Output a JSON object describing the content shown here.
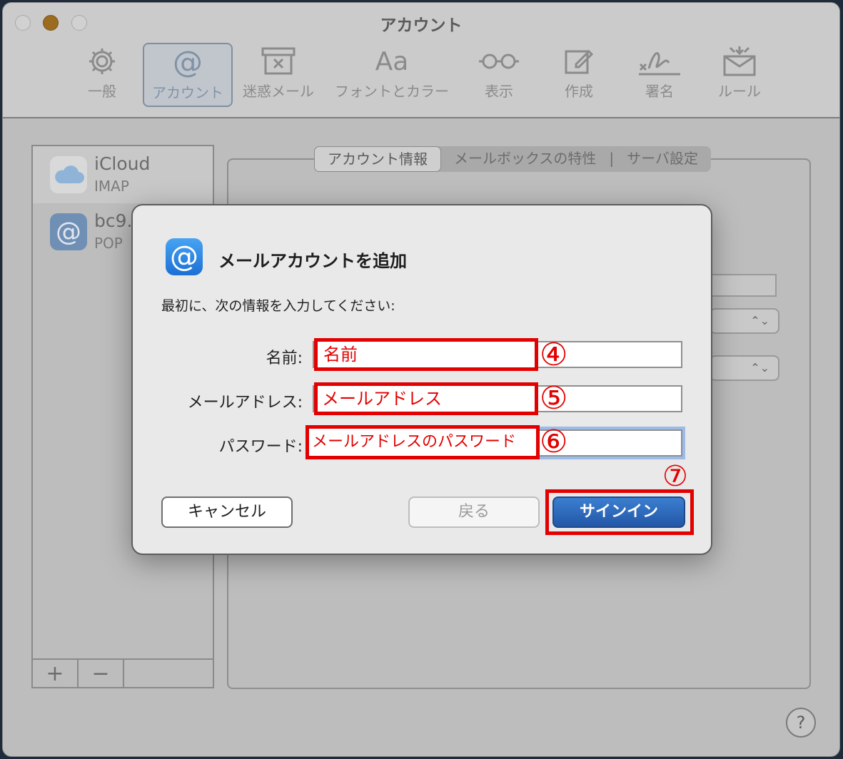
{
  "window": {
    "title": "アカウント"
  },
  "toolbar": {
    "items": [
      {
        "label": "一般",
        "icon": "gear-icon"
      },
      {
        "label": "アカウント",
        "icon": "at-icon",
        "active": true
      },
      {
        "label": "迷惑メール",
        "icon": "junk-box-icon"
      },
      {
        "label": "フォントとカラー",
        "icon": "font-icon"
      },
      {
        "label": "表示",
        "icon": "glasses-icon"
      },
      {
        "label": "作成",
        "icon": "compose-icon"
      },
      {
        "label": "署名",
        "icon": "signature-icon"
      },
      {
        "label": "ルール",
        "icon": "rules-envelope-icon"
      }
    ],
    "font_icon_text": "Aa"
  },
  "sidebar": {
    "accounts": [
      {
        "name": "iCloud",
        "type": "IMAP"
      },
      {
        "name": "bc9.",
        "type": "POP"
      }
    ],
    "add_label": "+",
    "remove_label": "−"
  },
  "tabs": {
    "items": [
      "アカウント情報",
      "メールボックスの特性",
      "サーバ設定"
    ],
    "separator": "|"
  },
  "dialog": {
    "title": "メールアカウントを追加",
    "prompt": "最初に、次の情報を入力してください:",
    "fields": [
      {
        "label": "名前:",
        "annotation": "名前",
        "marker": "④"
      },
      {
        "label": "メールアドレス:",
        "annotation": "メールアドレス",
        "marker": "⑤"
      },
      {
        "label": "パスワード:",
        "annotation": "メールアドレスのパスワード",
        "marker": "⑥"
      }
    ],
    "signin_marker": "⑦",
    "buttons": {
      "cancel": "キャンセル",
      "back": "戻る",
      "signin": "サインイン"
    }
  },
  "help": {
    "label": "?"
  },
  "colors": {
    "annotation_red": "#e30000",
    "primary_blue": "#2d67bb"
  }
}
